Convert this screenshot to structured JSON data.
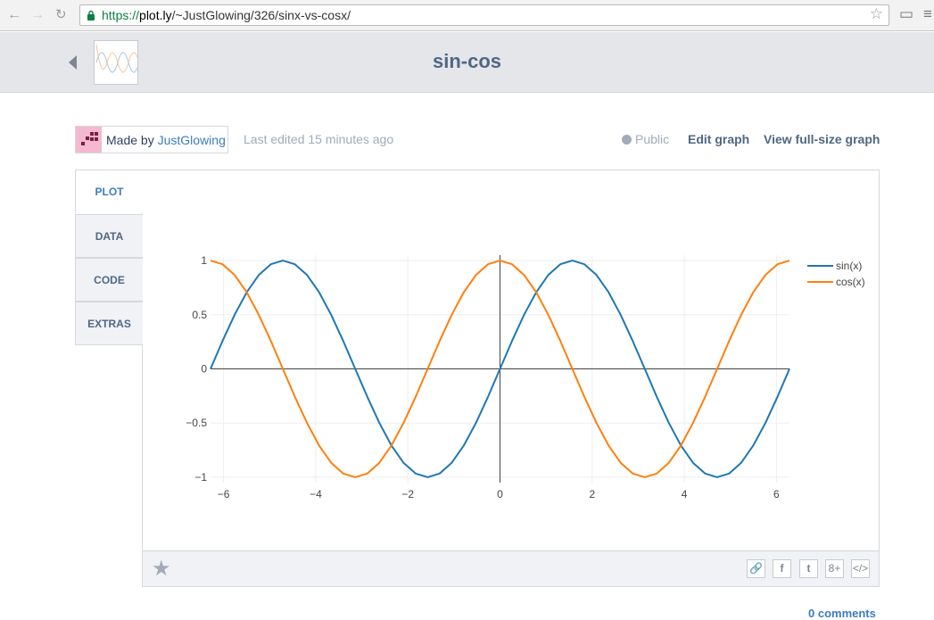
{
  "browser": {
    "url_scheme": "https://",
    "url_host": "plot.ly",
    "url_path": "/~JustGlowing/326/sinx-vs-cosx/"
  },
  "header": {
    "title": "sin-cos"
  },
  "meta": {
    "made_by_prefix": "Made by ",
    "author": "JustGlowing",
    "last_edited": "Last edited 15 minutes ago",
    "visibility": "Public",
    "edit_graph": "Edit graph",
    "view_full": "View full-size graph"
  },
  "tabs": [
    {
      "label": "PLOT",
      "active": true
    },
    {
      "label": "DATA",
      "active": false
    },
    {
      "label": "CODE",
      "active": false
    },
    {
      "label": "EXTRAS",
      "active": false
    }
  ],
  "footer": {
    "share_icons": [
      "link-icon",
      "facebook-icon",
      "twitter-icon",
      "google-plus-icon",
      "embed-icon"
    ],
    "share_glyphs": [
      "🔗",
      "f",
      "t",
      "8+",
      "</>"
    ],
    "comments": "0 comments"
  },
  "colors": {
    "sin": "#1f77b4",
    "cos": "#ff7f0e",
    "axis_text": "#444444",
    "grid": "#eeeeee"
  },
  "chart_data": {
    "type": "line",
    "title": "",
    "xlabel": "",
    "ylabel": "",
    "xlim": [
      -6.2832,
      6.2832
    ],
    "ylim": [
      -1.05,
      1.05
    ],
    "x_ticks": [
      -6,
      -4,
      -2,
      0,
      2,
      4,
      6
    ],
    "x_tick_labels": [
      "−6",
      "−4",
      "−2",
      "0",
      "2",
      "4",
      "6"
    ],
    "y_ticks": [
      -1,
      -0.5,
      0,
      0.5,
      1
    ],
    "y_tick_labels": [
      "−1",
      "−0.5",
      "0",
      "0.5",
      "1"
    ],
    "grid": true,
    "legend_position": "top-right",
    "x_start": -6.2832,
    "x_step": 0.2618,
    "series": [
      {
        "name": "sin(x)",
        "values": [
          0,
          0.2588,
          0.5,
          0.7071,
          0.866,
          0.9659,
          1,
          0.9659,
          0.866,
          0.7071,
          0.5,
          0.2588,
          0,
          -0.2588,
          -0.5,
          -0.7071,
          -0.866,
          -0.9659,
          -1,
          -0.9659,
          -0.866,
          -0.7071,
          -0.5,
          -0.2588,
          0,
          0.2588,
          0.5,
          0.7071,
          0.866,
          0.9659,
          1,
          0.9659,
          0.866,
          0.7071,
          0.5,
          0.2588,
          0,
          -0.2588,
          -0.5,
          -0.7071,
          -0.866,
          -0.9659,
          -1,
          -0.9659,
          -0.866,
          -0.7071,
          -0.5,
          -0.2588,
          0
        ]
      },
      {
        "name": "cos(x)",
        "values": [
          1,
          0.9659,
          0.866,
          0.7071,
          0.5,
          0.2588,
          0,
          -0.2588,
          -0.5,
          -0.7071,
          -0.866,
          -0.9659,
          -1,
          -0.9659,
          -0.866,
          -0.7071,
          -0.5,
          -0.2588,
          0,
          0.2588,
          0.5,
          0.7071,
          0.866,
          0.9659,
          1,
          0.9659,
          0.866,
          0.7071,
          0.5,
          0.2588,
          0,
          -0.2588,
          -0.5,
          -0.7071,
          -0.866,
          -0.9659,
          -1,
          -0.9659,
          -0.866,
          -0.7071,
          -0.5,
          -0.2588,
          0,
          0.2588,
          0.5,
          0.7071,
          0.866,
          0.9659,
          1
        ]
      }
    ]
  }
}
